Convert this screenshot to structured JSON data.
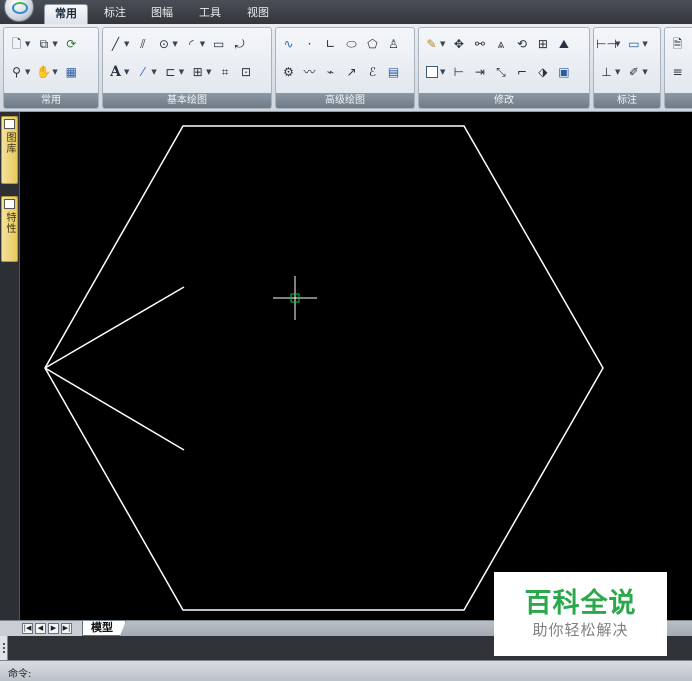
{
  "tabs": [
    {
      "label": "常用",
      "active": true
    },
    {
      "label": "标注",
      "active": false
    },
    {
      "label": "图幅",
      "active": false
    },
    {
      "label": "工具",
      "active": false
    },
    {
      "label": "视图",
      "active": false
    }
  ],
  "ribbon_groups": [
    {
      "label": "常用"
    },
    {
      "label": "基本绘图"
    },
    {
      "label": "高级绘图"
    },
    {
      "label": "修改"
    },
    {
      "label": "标注"
    }
  ],
  "palette_tabs": [
    {
      "label": "图库"
    },
    {
      "label": "特性"
    }
  ],
  "layout": {
    "model_tab": "模型",
    "nav": [
      "|◀",
      "◀",
      "▶",
      "▶|"
    ]
  },
  "command": {
    "prompt": "命令:"
  },
  "watermark": {
    "main": "百科全说",
    "sub": "助你轻松解决"
  },
  "colors": {
    "canvas_background": "#000000",
    "geometry_stroke": "#ffffff",
    "crosshair": "#ffffff",
    "pickbox": "#00cc44",
    "watermark_green": "#2aa84a"
  }
}
